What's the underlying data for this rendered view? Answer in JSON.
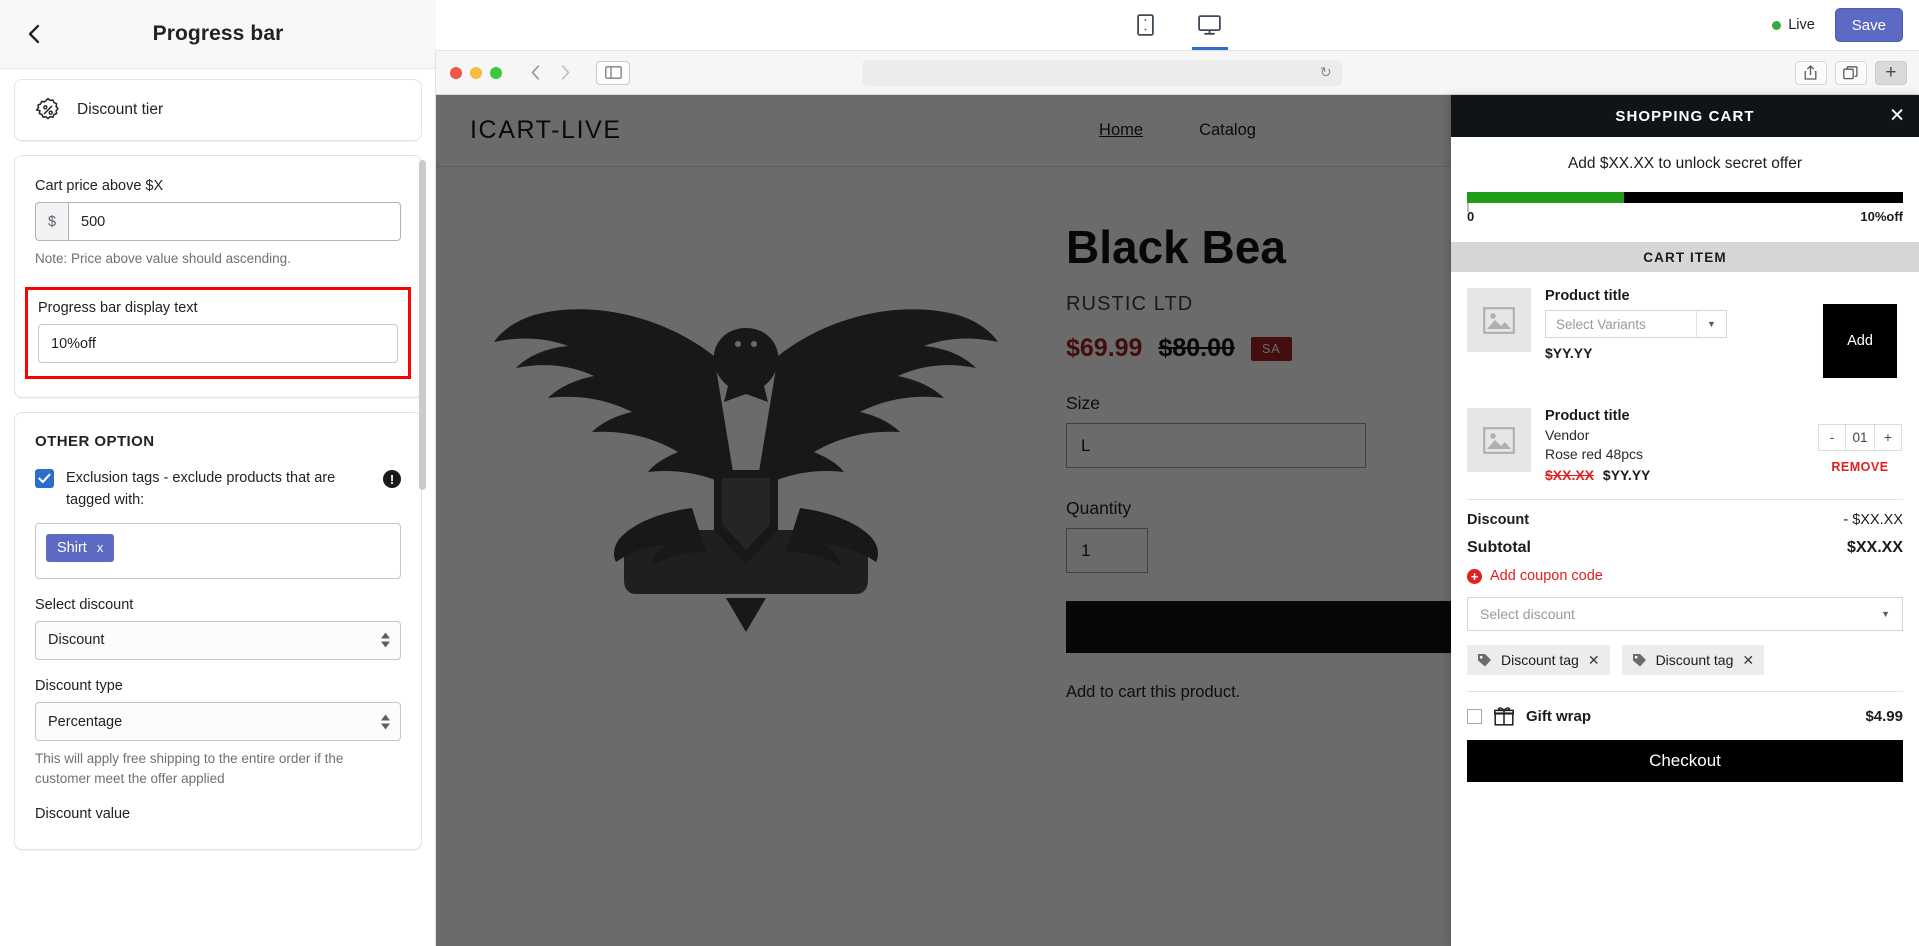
{
  "left_panel": {
    "back_icon": "chevron-left-icon",
    "title": "Progress bar",
    "tier": {
      "icon": "discount-percent-icon",
      "label": "Discount tier"
    },
    "cart_price": {
      "label": "Cart price above $X",
      "currency_prefix": "$",
      "value": "500",
      "note": "Note: Price above value should ascending."
    },
    "progress_text": {
      "label": "Progress bar display text",
      "value": "10%off",
      "highlight_color": "#ff0000"
    },
    "other_option": {
      "title": "OTHER OPTION",
      "exclusion_label": "Exclusion tags  - exclude products that are tagged with:",
      "info_badge": "!",
      "tags": [
        {
          "label": "Shirt",
          "remove": "x"
        }
      ],
      "select_discount_label": "Select discount",
      "select_discount_value": "Discount",
      "discount_type_label": "Discount type",
      "discount_type_value": "Percentage",
      "discount_type_help": "This will apply free shipping to the entire order if the customer meet the offer applied",
      "discount_value_label": "Discount value"
    }
  },
  "top_bar": {
    "mobile_icon": "mobile-device-icon",
    "desktop_icon": "desktop-device-icon",
    "live_label": "Live",
    "live_color": "#3aa83a",
    "save_label": "Save",
    "save_color": "#5c6ac4"
  },
  "browser": {
    "back_icon": "chevron-left-icon",
    "forward_icon": "chevron-right-icon",
    "sidebar_icon": "sidebar-toggle-icon",
    "reload_icon": "reload-icon",
    "url_value": "",
    "share_icon": "share-icon",
    "tabs_icon": "tab-overview-icon",
    "new_tab_icon": "plus-icon"
  },
  "store": {
    "logo": "ICART-LIVE",
    "nav": [
      {
        "label": "Home",
        "active": true
      },
      {
        "label": "Catalog",
        "active": false
      }
    ],
    "product": {
      "title": "Black Bea",
      "vendor": "RUSTIC LTD",
      "price_now": "$69.99",
      "price_was": "$80.00",
      "sale_badge": "SA",
      "size_label": "Size",
      "size_value": "L",
      "quantity_label": "Quantity",
      "quantity_value": "1",
      "note": "Add to cart this product."
    }
  },
  "cart": {
    "title": "SHOPPING CART",
    "close_icon": "close-icon",
    "promo_text": "Add $XX.XX to unlock secret offer",
    "progress": {
      "percent": 36,
      "fill_color": "#1f9d19",
      "track_color": "#000000",
      "start_label": "0",
      "end_label": "10%off"
    },
    "items_header": "CART ITEM",
    "items": [
      {
        "thumb_icon": "image-placeholder-icon",
        "title": "Product title",
        "variant_placeholder": "Select Variants",
        "price": "$YY.YY",
        "action": "Add",
        "type": "upsell"
      },
      {
        "thumb_icon": "image-placeholder-icon",
        "title": "Product title",
        "vendor": "Vendor",
        "variant": "Rose red 48pcs",
        "price_strike": "$XX.XX",
        "price_final": "$YY.YY",
        "qty_minus": "-",
        "qty_value": "01",
        "qty_plus": "+",
        "remove": "REMOVE",
        "type": "cart"
      }
    ],
    "totals": [
      {
        "label": "Discount",
        "value": "- $XX.XX",
        "bold": false
      },
      {
        "label": "Subtotal",
        "value": "$XX.XX",
        "bold": true
      }
    ],
    "coupon": {
      "icon": "plus-circle-icon",
      "label": "Add coupon code",
      "color": "#e02020"
    },
    "discount_select_placeholder": "Select discount",
    "discount_tags": [
      {
        "icon": "tag-icon",
        "label": "Discount tag",
        "remove_icon": "close-icon"
      },
      {
        "icon": "tag-icon",
        "label": "Discount tag",
        "remove_icon": "close-icon"
      }
    ],
    "giftwrap": {
      "icon": "gift-icon",
      "label": "Gift wrap",
      "price": "$4.99",
      "checked": false
    },
    "checkout_label": "Checkout"
  }
}
